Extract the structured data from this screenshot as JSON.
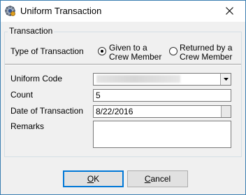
{
  "window": {
    "title": "Uniform Transaction",
    "close_symbol": "close-icon"
  },
  "transaction_group": {
    "legend": "Transaction",
    "type_label": "Type of Transaction",
    "options": [
      {
        "label": "Given to a\nCrew Member",
        "selected": true
      },
      {
        "label": "Returned by a\nCrew Member",
        "selected": false
      }
    ]
  },
  "form": {
    "uniform_code_label": "Uniform Code",
    "uniform_code_value": "",
    "count_label": "Count",
    "count_value": "5",
    "date_label": "Date of Transaction",
    "date_value": "8/22/2016",
    "remarks_label": "Remarks",
    "remarks_value": ""
  },
  "buttons": {
    "ok_mnemonic": "O",
    "ok_rest": "K",
    "cancel_mnemonic": "C",
    "cancel_rest": "ancel"
  },
  "colors": {
    "window_border": "#3c7fb1",
    "dialog_bg": "#f0f0f0",
    "default_button_border": "#0078d7"
  }
}
